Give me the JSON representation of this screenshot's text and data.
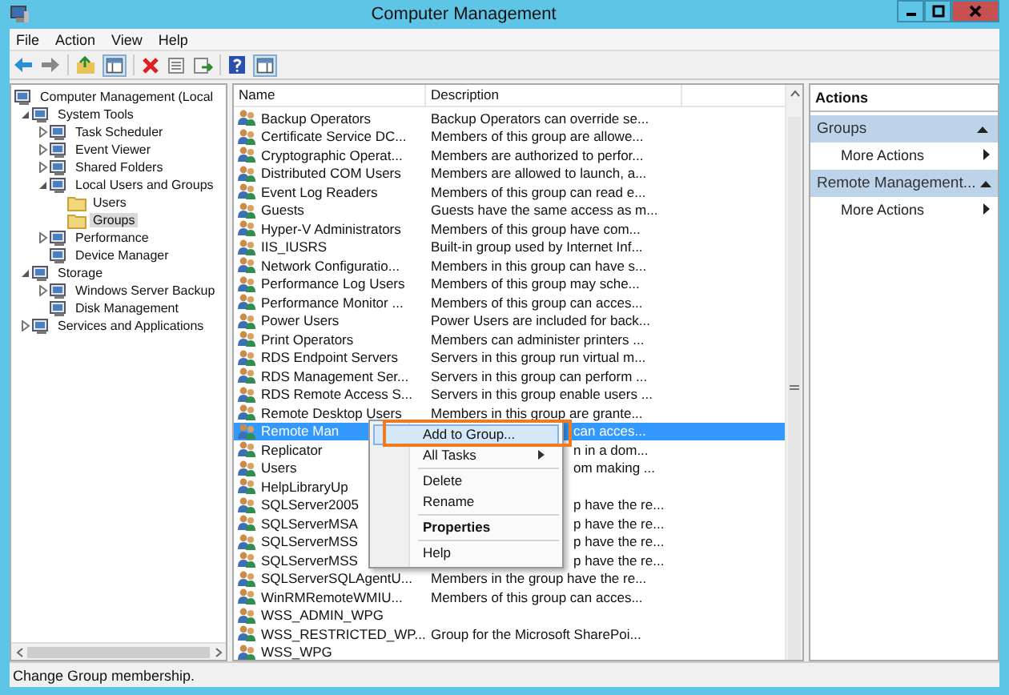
{
  "window": {
    "title": "Computer Management"
  },
  "menu": [
    "File",
    "Action",
    "View",
    "Help"
  ],
  "tree": [
    {
      "label": "Computer Management (Local",
      "selected": false,
      "children": [
        {
          "label": "System Tools",
          "expanded": true,
          "selected": false,
          "children": [
            {
              "label": "Task Scheduler",
              "expanded": false,
              "selected": false
            },
            {
              "label": "Event Viewer",
              "expanded": false,
              "selected": false
            },
            {
              "label": "Shared Folders",
              "expanded": false,
              "selected": false
            },
            {
              "label": "Local Users and Groups",
              "expanded": true,
              "selected": false,
              "children": [
                {
                  "label": "Users",
                  "selected": false
                },
                {
                  "label": "Groups",
                  "selected": true
                }
              ]
            },
            {
              "label": "Performance",
              "expanded": false,
              "selected": false
            },
            {
              "label": "Device Manager",
              "selected": false
            }
          ]
        },
        {
          "label": "Storage",
          "expanded": true,
          "selected": false,
          "children": [
            {
              "label": "Windows Server Backup",
              "expanded": false,
              "selected": false
            },
            {
              "label": "Disk Management",
              "selected": false
            }
          ]
        },
        {
          "label": "Services and Applications",
          "expanded": false,
          "selected": false
        }
      ]
    }
  ],
  "list": {
    "columns": [
      "Name",
      "Description"
    ],
    "rows": [
      {
        "name": "Backup Operators",
        "description": "Backup Operators can override se...",
        "selected": false
      },
      {
        "name": "Certificate Service DC...",
        "description": "Members of this group are allowe...",
        "selected": false
      },
      {
        "name": "Cryptographic Operat...",
        "description": "Members are authorized to perfor...",
        "selected": false
      },
      {
        "name": "Distributed COM Users",
        "description": "Members are allowed to launch, a...",
        "selected": false
      },
      {
        "name": "Event Log Readers",
        "description": "Members of this group can read e...",
        "selected": false
      },
      {
        "name": "Guests",
        "description": "Guests have the same access as m...",
        "selected": false
      },
      {
        "name": "Hyper-V Administrators",
        "description": "Members of this group have com...",
        "selected": false
      },
      {
        "name": "IIS_IUSRS",
        "description": "Built-in group used by Internet Inf...",
        "selected": false
      },
      {
        "name": "Network Configuratio...",
        "description": "Members in this group can have s...",
        "selected": false
      },
      {
        "name": "Performance Log Users",
        "description": "Members of this group may sche...",
        "selected": false
      },
      {
        "name": "Performance Monitor ...",
        "description": "Members of this group can acces...",
        "selected": false
      },
      {
        "name": "Power Users",
        "description": "Power Users are included for back...",
        "selected": false
      },
      {
        "name": "Print Operators",
        "description": "Members can administer printers ...",
        "selected": false
      },
      {
        "name": "RDS Endpoint Servers",
        "description": "Servers in this group run virtual m...",
        "selected": false
      },
      {
        "name": "RDS Management Ser...",
        "description": "Servers in this group can perform ...",
        "selected": false
      },
      {
        "name": "RDS Remote Access S...",
        "description": "Servers in this group enable users ...",
        "selected": false
      },
      {
        "name": "Remote Desktop Users",
        "description": "Members in this group are grante...",
        "selected": false
      },
      {
        "name": "Remote Man",
        "description": "can acces...",
        "covered": true,
        "selected": true
      },
      {
        "name": "Replicator",
        "description": "n in a dom...",
        "covered": true,
        "selected": false
      },
      {
        "name": "Users",
        "description": "om making ...",
        "covered": true,
        "selected": false
      },
      {
        "name": "HelpLibraryUp",
        "selected": false
      },
      {
        "name": "SQLServer2005",
        "description": "p have the re...",
        "covered": true,
        "selected": false
      },
      {
        "name": "SQLServerMSA",
        "description": "p have the re...",
        "covered": true,
        "selected": false
      },
      {
        "name": "SQLServerMSS",
        "description": "p have the re...",
        "covered": true,
        "selected": false
      },
      {
        "name": "SQLServerMSS",
        "description": "p have the re...",
        "covered": true,
        "selected": false
      },
      {
        "name": "SQLServerSQLAgentU...",
        "description": "Members in the group have the re...",
        "selected": false
      },
      {
        "name": "WinRMRemoteWMIU...",
        "description": "Members of this group can acces...",
        "selected": false
      },
      {
        "name": "WSS_ADMIN_WPG",
        "selected": false
      },
      {
        "name": "WSS_RESTRICTED_WP...",
        "description": "Group for the Microsoft SharePoi...",
        "selected": false
      },
      {
        "name": "WSS_WPG",
        "selected": false
      }
    ]
  },
  "context_menu": {
    "items": [
      {
        "kind": "item",
        "label": "Add to Group...",
        "selected": true
      },
      {
        "kind": "submenu",
        "label": "All Tasks",
        "selected": false
      },
      {
        "kind": "separator"
      },
      {
        "kind": "item",
        "label": "Delete",
        "selected": false
      },
      {
        "kind": "item",
        "label": "Rename",
        "selected": false
      },
      {
        "kind": "separator"
      },
      {
        "kind": "default",
        "label": "Properties",
        "selected": false
      },
      {
        "kind": "separator"
      },
      {
        "kind": "item",
        "label": "Help",
        "selected": false
      }
    ]
  },
  "actions": {
    "title": "Actions",
    "sections": [
      {
        "title": "Groups",
        "expanded": true,
        "items": [
          "More Actions"
        ]
      },
      {
        "title": "Remote Management...",
        "expanded": true,
        "items": [
          "More Actions"
        ]
      }
    ]
  },
  "status_bar": "Change Group membership."
}
